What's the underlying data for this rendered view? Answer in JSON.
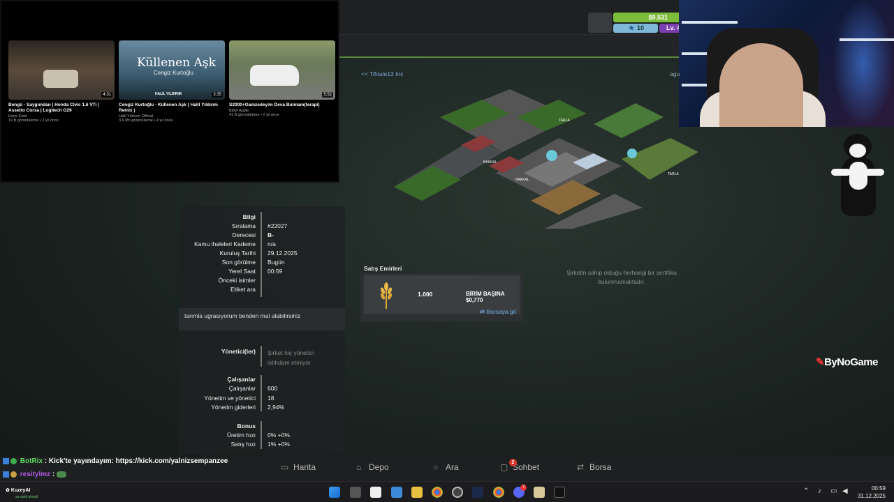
{
  "header": {
    "cash": "$9.531",
    "stars": "10",
    "level": "Lv. 4"
  },
  "youtube": {
    "videos": [
      {
        "title": "Bengü - Saygımdan | Honda Civic 1.6 VTi | Assetto Corsa | Logitech G29",
        "channel": "Emre Esen",
        "meta": "19 B görüntüleme • 2 yıl önce",
        "duration": "4:31"
      },
      {
        "title": "Cengiz Kurtoğlu - Küllenen Aşk ( Halil Yıldırım Remix )",
        "channel": "Halil Yıldırım Official",
        "meta": "3,6 Mn görüntüleme • 4 yıl önce",
        "duration": "3:35",
        "thumb_title": "Küllenen Aşk",
        "thumb_sub": "Cengiz Kurtoğlu",
        "thumb_credit": "HALİL YILDIRIM"
      },
      {
        "title": "S2000+Gamzedeyim Deva Bulmam(terapi)",
        "channel": "Bitter Apple",
        "meta": "41 B görüntüleme • 2 yıl önce",
        "duration": "5:52"
      }
    ]
  },
  "company": {
    "back_link": "<< Tifoule13 Inc",
    "right_link": "agu",
    "info_title": "Bilgi",
    "rows": [
      {
        "k": "Sıralama",
        "v": "#22027"
      },
      {
        "k": "Derecesi",
        "v": "B-"
      },
      {
        "k": "Kamu ihaleleri Kademe",
        "v": "n/a"
      },
      {
        "k": "Kuruluş Tarihi",
        "v": "29.12.2025"
      },
      {
        "k": "Son görülme",
        "v": "Bugün"
      },
      {
        "k": "Yerel Saat",
        "v": "00:59"
      },
      {
        "k": "Önceki isimler",
        "v": ""
      },
      {
        "k": "Etiket ara",
        "v": ""
      }
    ],
    "description": "tarımla ugrasıyorum benden mal alabilirsiniz",
    "managers_title": "Yönetici(ler)",
    "managers_empty": "Şirket hiç yönetici istihdam etmiyor",
    "employees_title": "Çalışanlar",
    "employees": [
      {
        "k": "Çalışanlar",
        "v": "600"
      },
      {
        "k": "Yönetim ve yönetici",
        "v": "18"
      },
      {
        "k": "Yönetim giderleri",
        "v": "2,94%"
      }
    ],
    "bonus_title": "Bonus",
    "bonus": [
      {
        "k": "Üretim hızı",
        "v": "0% +0%"
      },
      {
        "k": "Satış hızı",
        "v": "1% +0%"
      }
    ],
    "sales_title": "Satış Emirleri",
    "sales_qty": "1.000",
    "sales_unit": "BİRİM BAŞINA $0,770",
    "sales_link": "Borsaya git",
    "cert_text": "Şirketin sahip olduğu herhangi bir sertifika bulunmamaktadır.",
    "city_labels": [
      "TARLA",
      "BAKKAL",
      "BAKKAL",
      "TARLA"
    ]
  },
  "watermark": "ByNoGame",
  "game_nav": {
    "items": [
      "Harita",
      "Depo",
      "Ara",
      "Sohbet",
      "Borsa"
    ],
    "chat_badge": "2"
  },
  "chat": {
    "line1_user": "BotRix",
    "line1_text": ": Kick'te yayındayım: https://kick.com/yalnizsempanzee",
    "line2_user": "resitylmz",
    "line2_text": ":"
  },
  "taskbar": {
    "user": "KuzeyAI",
    "user_sub": "su vakti ahmdi",
    "time": "00:59",
    "date": "31.12.2025",
    "discord_badge": "7"
  }
}
